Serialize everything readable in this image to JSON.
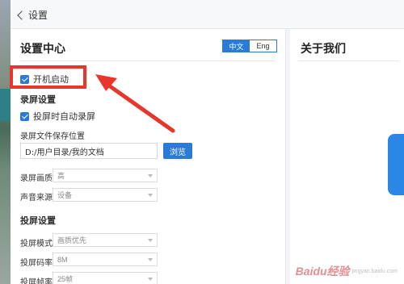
{
  "titlebar": {
    "back_label": "设置"
  },
  "settings": {
    "title": "设置中心",
    "lang": {
      "zh": "中文",
      "en": "Eng"
    },
    "startup_label": "开机启动",
    "record_section": "录屏设置",
    "auto_record_label": "投屏时自动录屏",
    "save_path_label": "录屏文件保存位置",
    "save_path_value": "D:/用户目录/我的文档",
    "browse_label": "浏览",
    "quality_label": "录屏画质",
    "quality_value": "高",
    "audio_label": "声音来源",
    "audio_value": "设备",
    "cast_section": "投屏设置",
    "mode_label": "投屏模式",
    "mode_value": "画质优先",
    "bitrate_label": "投屏码率",
    "bitrate_value": "8M",
    "fps_label": "投屏帧率",
    "fps_value": "25帧"
  },
  "about": {
    "title": "关于我们"
  },
  "watermark": {
    "brand": "Baidu经验",
    "url": "jingyan.baidu.com"
  },
  "colors": {
    "accent": "#2b7ad8",
    "annotation": "#e8362b"
  }
}
